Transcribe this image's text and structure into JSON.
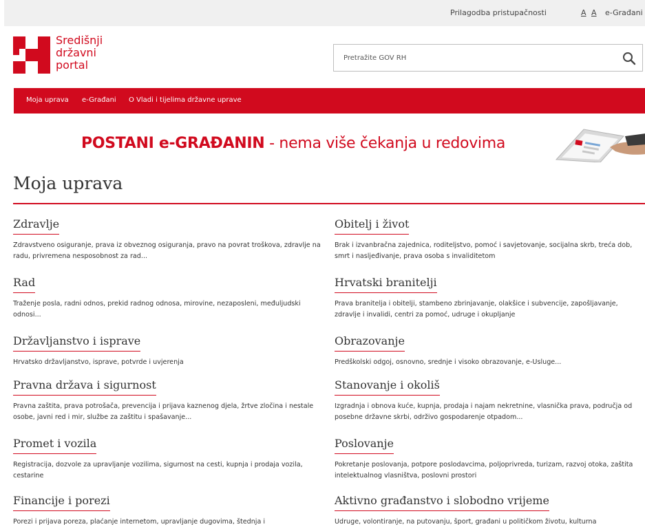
{
  "topbar": {
    "accessibility": "Prilagodba pristupačnosti",
    "font_small": "A",
    "font_large": "A",
    "egradani": "e-Građani"
  },
  "logo": {
    "line1": "Središnji",
    "line2": "državni",
    "line3": "portal"
  },
  "search": {
    "placeholder": "Pretražite GOV RH"
  },
  "nav": {
    "items": [
      "Moja uprava",
      "e-Građani",
      "O Vladi i tijelima državne uprave"
    ]
  },
  "banner": {
    "bold": "POSTANI e-GRAĐANIN",
    "rest": " - nema više čekanja u redovima"
  },
  "page_title": "Moja uprava",
  "categories_left": [
    {
      "title": "Zdravlje",
      "desc": "Zdravstveno osiguranje, prava iz obveznog osiguranja, pravo na povrat troškova, zdravlje na radu, privremena nesposobnost za rad..."
    },
    {
      "title": "Rad",
      "desc": "Traženje posla, radni odnos, prekid radnog odnosa, mirovine, nezaposleni, međuljudski odnosi..."
    },
    {
      "title": "Državljanstvo i isprave",
      "desc": "Hrvatsko državljanstvo, isprave, potvrde i uvjerenja"
    },
    {
      "title": "Pravna država i sigurnost",
      "desc": "Pravna zaštita, prava potrošača, prevencija i prijava kaznenog djela, žrtve zločina i nestale osobe, javni red i mir, službe za zaštitu i spašavanje..."
    },
    {
      "title": "Promet i vozila",
      "desc": "Registracija, dozvole za upravljanje vozilima, sigurnost na cesti, kupnja i prodaja vozila, cestarine"
    },
    {
      "title": "Financije i porezi",
      "desc": "Porezi i prijava poreza, plaćanje internetom, upravljanje dugovima, štednja i"
    }
  ],
  "categories_right": [
    {
      "title": "Obitelj i život",
      "desc": "Brak i izvanbračna zajednica, roditeljstvo, pomoć i savjetovanje, socijalna skrb, treća dob, smrt i nasljeđivanje, prava osoba s invaliditetom"
    },
    {
      "title": "Hrvatski branitelji",
      "desc": "Prava branitelja i obitelji, stambeno zbrinjavanje, olakšice i subvencije, zapošljavanje, zdravlje i invalidi, centri za pomoć, udruge i okupljanje"
    },
    {
      "title": "Obrazovanje",
      "desc": "Predškolski odgoj, osnovno, srednje i visoko obrazovanje, e-Usluge..."
    },
    {
      "title": "Stanovanje i okoliš",
      "desc": "Izgradnja i obnova kuće, kupnja, prodaja i najam nekretnine, vlasnička prava, područja od posebne državne skrbi, održivo gospodarenje otpadom..."
    },
    {
      "title": "Poslovanje",
      "desc": "Pokretanje poslovanja, potpore poslodavcima, poljoprivreda, turizam, razvoj otoka, zaštita intelektualnog vlasništva, poslovni prostori"
    },
    {
      "title": "Aktivno građanstvo i slobodno vrijeme",
      "desc": "Udruge, volontiranje, na putovanju, šport, građani u političkom životu, kulturna"
    }
  ],
  "colors": {
    "brand_red": "#d10a1e",
    "topbar_bg": "#f0f0f0",
    "text": "#333333"
  }
}
